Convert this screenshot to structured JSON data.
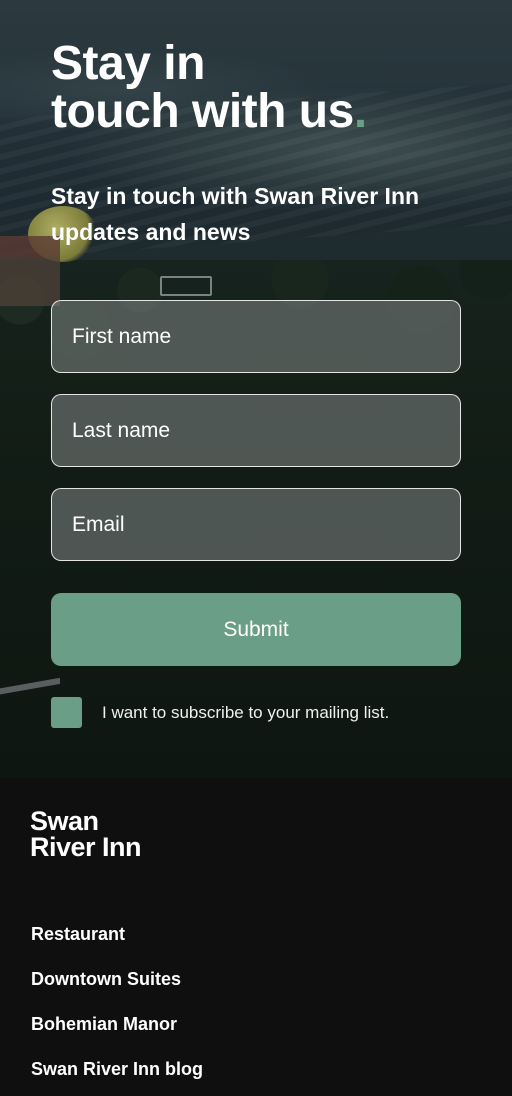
{
  "hero": {
    "headline_line1": "Stay in",
    "headline_line2": "touch with us",
    "headline_dot": ".",
    "subhead": "Stay in touch with Swan River Inn updates and news"
  },
  "form": {
    "first_name_placeholder": "First name",
    "last_name_placeholder": "Last name",
    "email_placeholder": "Email",
    "submit_label": "Submit",
    "subscribe_label": "I want to subscribe to your mailing list."
  },
  "footer": {
    "logo_line1": "Swan",
    "logo_line2": "River Inn",
    "links": [
      {
        "label": "Restaurant"
      },
      {
        "label": "Downtown Suites"
      },
      {
        "label": "Bohemian Manor"
      },
      {
        "label": "Swan River Inn blog"
      }
    ]
  },
  "colors": {
    "accent": "#6a9e86",
    "footer_bg": "#0f0f0f"
  }
}
